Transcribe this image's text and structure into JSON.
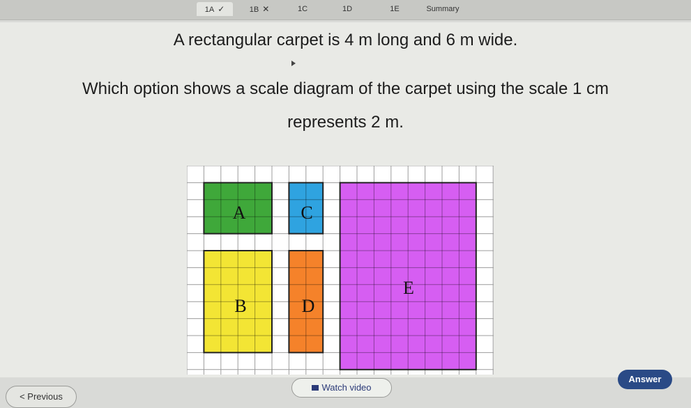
{
  "tabs": [
    {
      "label": "1A",
      "mark": "✓",
      "active": true
    },
    {
      "label": "1B",
      "mark": "✕",
      "active": false
    },
    {
      "label": "1C",
      "mark": "",
      "active": false
    },
    {
      "label": "1D",
      "mark": "",
      "active": false
    },
    {
      "label": "1E",
      "mark": "",
      "active": false
    },
    {
      "label": "Summary",
      "mark": "",
      "active": false
    }
  ],
  "question": {
    "line1": "A rectangular carpet is 4 m long and 6 m wide.",
    "line2": "Which option shows a scale diagram of the carpet using the scale 1 cm",
    "line3": "represents 2 m."
  },
  "options": [
    {
      "label": "A",
      "color": "#3fa83a"
    },
    {
      "label": "B",
      "color": "#f3e534"
    },
    {
      "label": "C",
      "color": "#2fa3e0"
    },
    {
      "label": "D",
      "color": "#f5822a"
    },
    {
      "label": "E",
      "color": "#d65ef2"
    }
  ],
  "grid_color": "#9c9c9c",
  "buttons": {
    "previous": "< Previous",
    "watch_video": "Watch video",
    "answer": "Answer"
  },
  "colors": {
    "answer_bg": "#2a4a86",
    "video_text": "#2b3a78"
  }
}
